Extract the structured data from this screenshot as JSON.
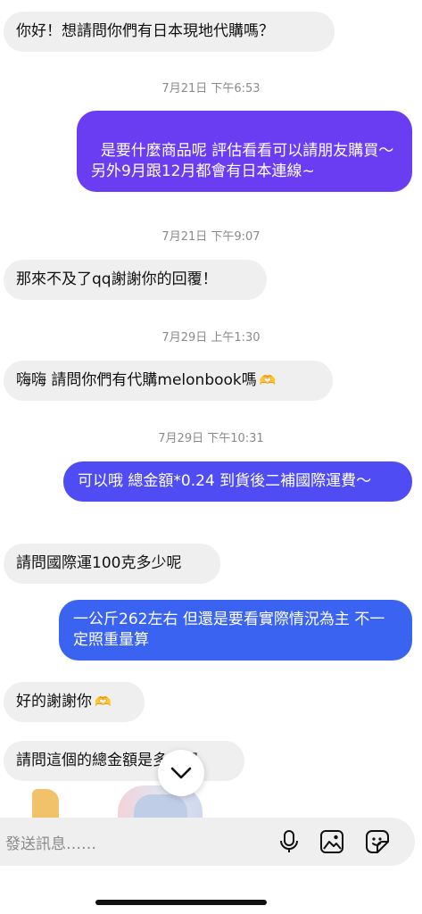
{
  "messages": [
    {
      "dir": "in",
      "text": "你好！想請問你們有日本現地代購嗎？"
    },
    {
      "dir": "out",
      "text": "是要什麼商品呢 評估看看可以請朋友購買～\n另外9月跟12月都會有日本連線~"
    },
    {
      "dir": "in",
      "text": "那來不及了qq謝謝你的回覆！"
    },
    {
      "dir": "in",
      "text": "嗨嗨 請問你們有代購melonbook嗎"
    },
    {
      "dir": "out",
      "text": "可以哦 總金額*0.24 到貨後二補國際運費～"
    },
    {
      "dir": "in",
      "text": "請問國際運100克多少呢"
    },
    {
      "dir": "out",
      "text": "一公斤262左右 但還是要看實際情況為主 不一定照重量算"
    },
    {
      "dir": "in",
      "text": "好的謝謝你"
    },
    {
      "dir": "in",
      "text": "請問這個的總金額是多少呢"
    }
  ],
  "timestamps": [
    "7月21日 下午6:53",
    "7月21日 下午9:07",
    "7月29日 上午1:30",
    "7月29日 下午10:31"
  ],
  "composer": {
    "placeholder": "發送訊息……"
  },
  "icons": {
    "heart_hands": "heart-hands-emoji",
    "scroll_down": "chevron-down-icon",
    "microphone": "microphone-icon",
    "gallery": "image-icon",
    "sticker": "sticker-icon"
  },
  "colors": {
    "incoming_bubble": "#efefef",
    "outgoing_purple": "#6a3cf2",
    "outgoing_indigo": "#4f4cf3",
    "outgoing_blue": "#3a63f2"
  }
}
